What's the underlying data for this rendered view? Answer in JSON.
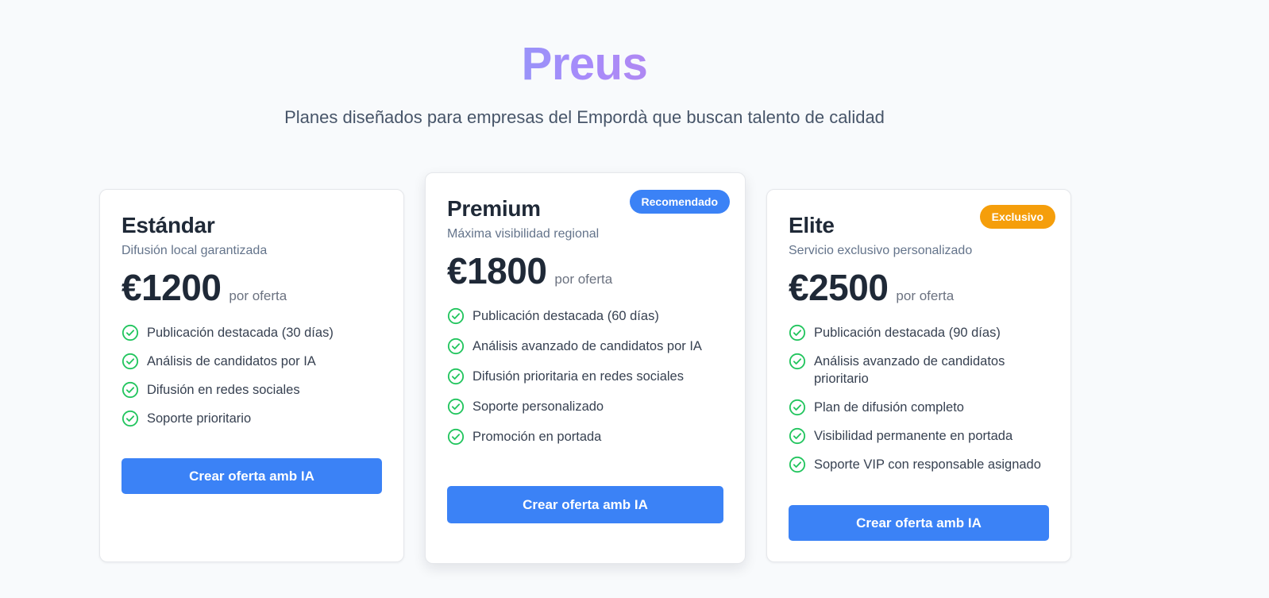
{
  "header": {
    "title": "Preus",
    "subtitle": "Planes diseñados para empresas del Empordà que buscan talento de calidad"
  },
  "colors": {
    "accent": "#3b82f6",
    "check": "#22c55e",
    "badge_exclusive": "#f59e0b",
    "title_gradient": [
      "#22d3ee",
      "#a78bfa",
      "#f472b6"
    ]
  },
  "plans": [
    {
      "name": "Estándar",
      "description": "Difusión local garantizada",
      "price": "€1200",
      "per": "por oferta",
      "features": [
        "Publicación destacada (30 días)",
        "Análisis de candidatos por IA",
        "Difusión en redes sociales",
        "Soporte prioritario"
      ],
      "cta": "Crear oferta amb IA"
    },
    {
      "name": "Premium",
      "description": "Máxima visibilidad regional",
      "price": "€1800",
      "per": "por oferta",
      "badge": "Recomendado",
      "features": [
        "Publicación destacada (60 días)",
        "Análisis avanzado de candidatos por IA",
        "Difusión prioritaria en redes sociales",
        "Soporte personalizado",
        "Promoción en portada"
      ],
      "cta": "Crear oferta amb IA"
    },
    {
      "name": "Elite",
      "description": "Servicio exclusivo personalizado",
      "price": "€2500",
      "per": "por oferta",
      "badge": "Exclusivo",
      "features": [
        "Publicación destacada (90 días)",
        "Análisis avanzado de candidatos prioritario",
        "Plan de difusión completo",
        "Visibilidad permanente en portada",
        "Soporte VIP con responsable asignado"
      ],
      "cta": "Crear oferta amb IA"
    }
  ]
}
